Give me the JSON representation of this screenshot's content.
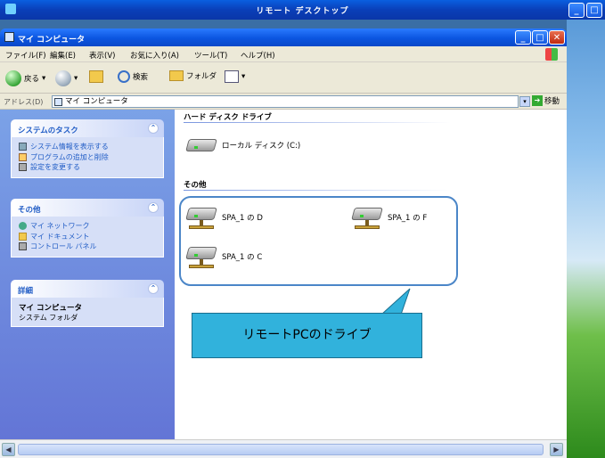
{
  "remote_window": {
    "title": "リモート デスクトップ"
  },
  "window": {
    "title": "マイ コンピュータ"
  },
  "menu": [
    "ファイル(F)",
    "編集(E)",
    "表示(V)",
    "お気に入り(A)",
    "ツール(T)",
    "ヘルプ(H)"
  ],
  "toolbar": {
    "back_label": "戻る",
    "search_label": "検索",
    "folders_label": "フォルダ"
  },
  "address": {
    "label": "アドレス(D)",
    "value": "マイ コンピュータ",
    "go_label": "移動"
  },
  "left_panels": {
    "system_tasks": {
      "title": "システムのタスク",
      "items": [
        "システム情報を表示する",
        "プログラムの追加と削除",
        "設定を変更する"
      ]
    },
    "other": {
      "title": "その他",
      "items": [
        "マイ ネットワーク",
        "マイ ドキュメント",
        "コントロール パネル"
      ]
    },
    "details": {
      "title": "詳細",
      "name": "マイ コンピュータ",
      "desc": "システム フォルダ"
    }
  },
  "main": {
    "section_hdd": "ハード ディスク ドライブ",
    "local_disk": "ローカル ディスク (C:)",
    "section_other": "その他",
    "remote_drives": [
      "SPA_1 の D",
      "SPA_1 の F",
      "SPA_1 の C"
    ]
  },
  "callout": "リモートPCのドライブ"
}
